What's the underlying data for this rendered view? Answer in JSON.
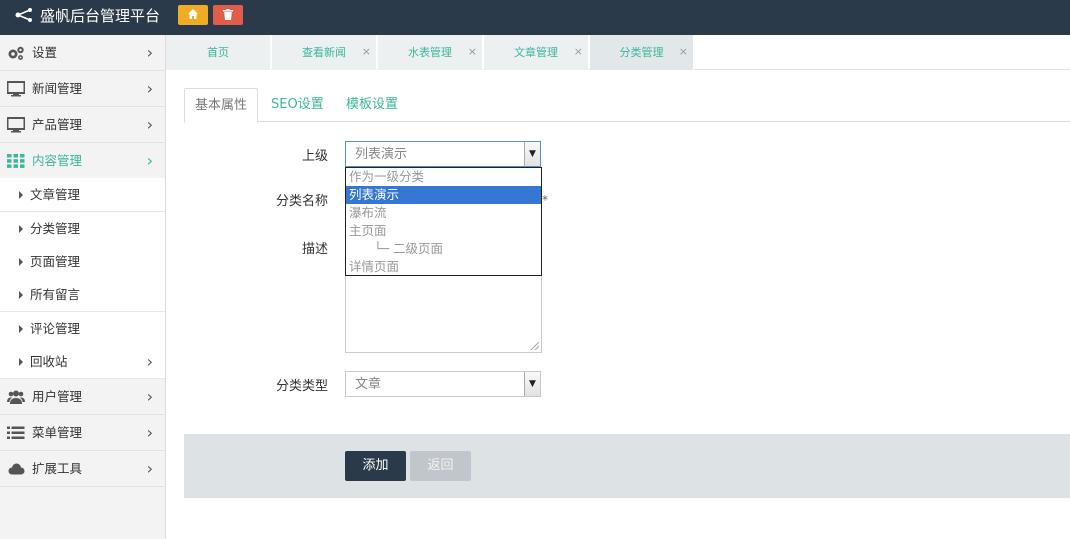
{
  "app": {
    "title": "盛帆后台管理平台"
  },
  "topbar": {
    "home_icon": "home-icon",
    "delete_icon": "trash-icon",
    "home_color": "#f0ad23",
    "delete_color": "#e05d4a"
  },
  "sidebar": {
    "items": [
      {
        "label": "设置",
        "icon": "gears-icon"
      },
      {
        "label": "新闻管理",
        "icon": "monitor-icon"
      },
      {
        "label": "产品管理",
        "icon": "monitor-icon"
      },
      {
        "label": "内容管理",
        "icon": "grid-icon",
        "active": true
      },
      {
        "label": "用户管理",
        "icon": "users-icon"
      },
      {
        "label": "菜单管理",
        "icon": "list-icon"
      },
      {
        "label": "扩展工具",
        "icon": "cloud-icon"
      }
    ],
    "subitems": [
      {
        "label": "文章管理"
      },
      {
        "label": "分类管理"
      },
      {
        "label": "页面管理"
      },
      {
        "label": "所有留言"
      },
      {
        "label": "评论管理"
      },
      {
        "label": "回收站"
      }
    ]
  },
  "page_tabs": [
    {
      "label": "首页",
      "closable": false
    },
    {
      "label": "查看新闻",
      "closable": true
    },
    {
      "label": "水表管理",
      "closable": true
    },
    {
      "label": "文章管理",
      "closable": true
    },
    {
      "label": "分类管理",
      "closable": true,
      "active": true
    }
  ],
  "close_glyph": "×",
  "content_tabs": [
    {
      "label": "基本属性",
      "active": true
    },
    {
      "label": "SEO设置"
    },
    {
      "label": "模板设置"
    }
  ],
  "form": {
    "parent_label": "上级",
    "parent_value": "列表演示",
    "parent_options": [
      "作为一级分类",
      "列表演示",
      "瀑布流",
      "主页面",
      "└─ 二级页面",
      "详情页面"
    ],
    "parent_selected_index": 1,
    "name_label": "分类名称",
    "required_mark": "*",
    "desc_label": "描述",
    "type_label": "分类类型",
    "type_value": "文章"
  },
  "actions": {
    "add_label": "添加",
    "back_label": "返回"
  },
  "colors": {
    "accent": "#3bb79a",
    "topbar": "#2b3a4a",
    "highlight": "#3478d4"
  }
}
